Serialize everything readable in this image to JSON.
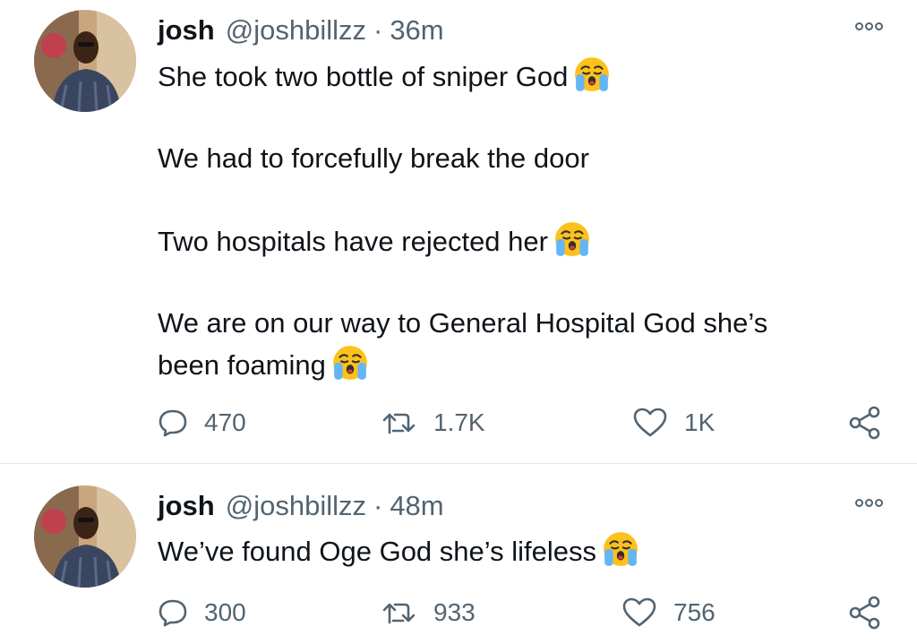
{
  "tweets": [
    {
      "name": "josh",
      "handle": "@joshbillzz",
      "separator": "·",
      "time": "36m",
      "lines": [
        "She took two bottle of sniper God",
        "We had to forcefully break the door",
        "Two hospitals have rejected her",
        "We are on our way to General Hospital God she’s",
        "been foaming"
      ],
      "emoji": "loudly-crying-face",
      "replies": "470",
      "retweets": "1.7K",
      "likes": "1K"
    },
    {
      "name": "josh",
      "handle": "@joshbillzz",
      "separator": "·",
      "time": "48m",
      "lines": [
        "We’ve found Oge God she’s lifeless"
      ],
      "emoji": "loudly-crying-face",
      "replies": "300",
      "retweets": "933",
      "likes": "756"
    }
  ],
  "colors": {
    "text": "#0f1419",
    "secondary": "#536471",
    "divider": "#e6e9eb"
  },
  "icons": [
    "reply-icon",
    "retweet-icon",
    "like-icon",
    "share-icon",
    "more-options-icon"
  ]
}
